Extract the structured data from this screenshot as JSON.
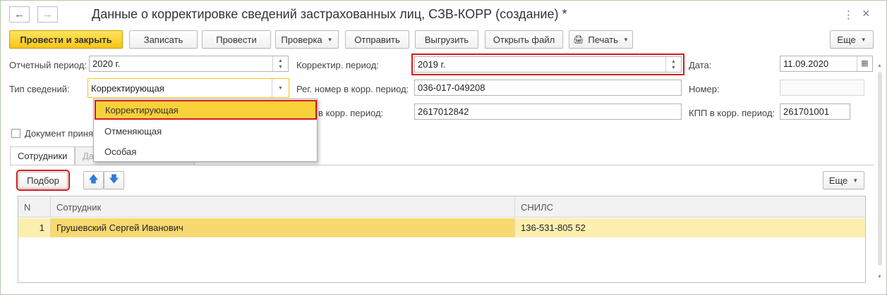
{
  "window": {
    "title": "Данные о корректировке сведений застрахованных лиц, СЗВ-КОРР (создание) *",
    "back_icon": "arrow-left-icon",
    "forward_icon": "arrow-right-icon",
    "menu_icon": "kebab-icon",
    "close_icon": "close-icon",
    "close_glyph": "×",
    "menu_glyph": "⋮"
  },
  "toolbar": {
    "post_close": "Провести и закрыть",
    "save": "Записать",
    "post": "Провести",
    "check": "Проверка",
    "send": "Отправить",
    "export": "Выгрузить",
    "open_file": "Открыть файл",
    "print": "Печать",
    "more": "Еще"
  },
  "form": {
    "report_period_label": "Отчетный период:",
    "report_period_value": "2020 г.",
    "corr_period_label": "Корректир. период:",
    "corr_period_value": "2019 г.",
    "date_label": "Дата:",
    "date_value": "11.09.2020",
    "info_type_label": "Тип сведений:",
    "info_type_value": "Корректирующая",
    "reg_num_label": "Рег. номер в корр. период:",
    "reg_num_value": "036-017-049208",
    "number_label": "Номер:",
    "number_value": "",
    "inn_label_partial": "в корр. период:",
    "inn_value": "2617012842",
    "kpp_label": "КПП в корр. период:",
    "kpp_value": "261701001",
    "doc_accepted_label": "Документ приня"
  },
  "dropdown": {
    "options": [
      "Корректирующая",
      "Отменяющая",
      "Особая"
    ],
    "selected": "Корректирующая"
  },
  "tabs": [
    {
      "label": "Сотрудники",
      "active": true
    },
    {
      "label": "Да",
      "active": false
    }
  ],
  "table_toolbar": {
    "pick": "Подбор",
    "more": "Еще"
  },
  "table": {
    "columns": [
      "N",
      "Сотрудник",
      "СНИЛС"
    ],
    "rows": [
      {
        "n": "1",
        "employee": "Грушевский Сергей Иванович",
        "snils": "136-531-805 52"
      }
    ]
  },
  "colors": {
    "accent_yellow": "#f5c518",
    "highlight_red": "#d7191c",
    "row_selected": "#fcefb0"
  }
}
